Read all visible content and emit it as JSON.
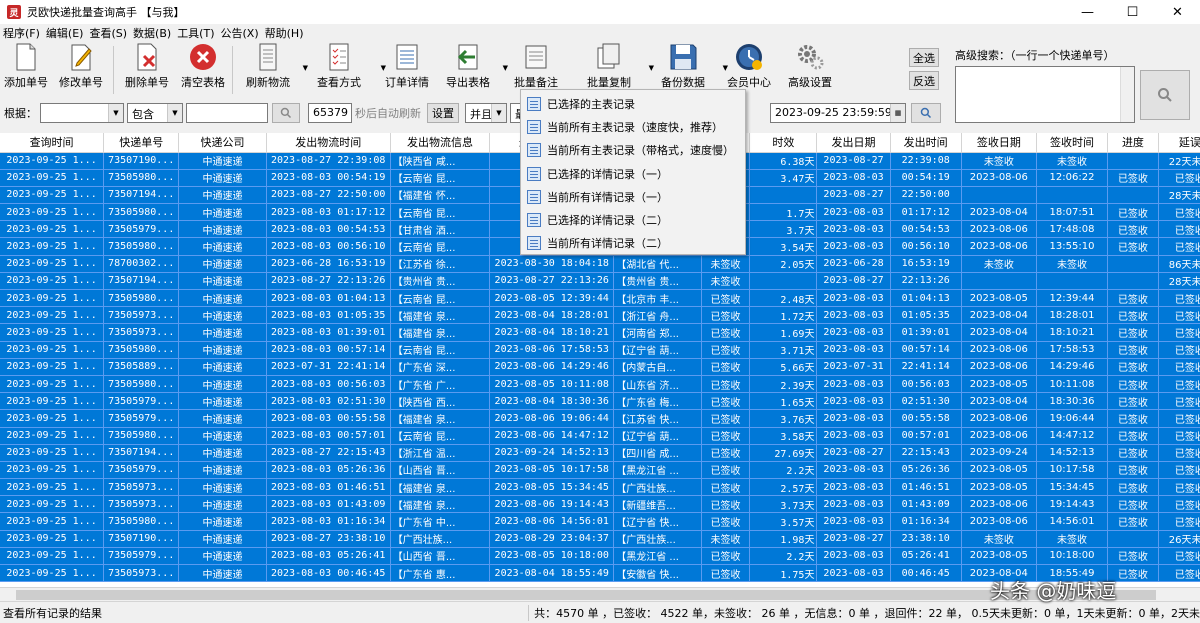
{
  "window": {
    "title": "灵欧快递批量查询高手 【与我】",
    "min": "—",
    "max": "☐",
    "close": "✕",
    "icon_text": "灵"
  },
  "menu": [
    "程序(F)",
    "编辑(E)",
    "查看(S)",
    "数据(B)",
    "工具(T)",
    "公告(X)",
    "帮助(H)"
  ],
  "toolbar": {
    "add": "添加单号",
    "edit": "修改单号",
    "delete": "删除单号",
    "clear": "清空表格",
    "refresh": "刷新物流",
    "view": "查看方式",
    "detail": "订单详情",
    "export": "导出表格",
    "remark": "批量备注",
    "copy": "批量复制",
    "backup": "备份数据",
    "member": "会员中心",
    "settings": "高级设置"
  },
  "side_buttons": {
    "select_all": "全选",
    "invert": "反选"
  },
  "advanced_search": {
    "label": "高级搜索：（一行一个快递单号）"
  },
  "filter": {
    "basis_label": "根据：",
    "basis_value": "",
    "op_value": "包含",
    "keyword": "",
    "seconds": "65379",
    "auto_refresh": "秒后自动刷新",
    "settings_btn": "设置",
    "logic": "并且",
    "last": "最后",
    "date": "2023-09-25  23:59:59"
  },
  "columns": [
    "查询时间",
    "快递单号",
    "快递公司",
    "发出物流时间",
    "发出物流信息",
    "最后物流时间",
    "最后物流信息",
    "状态",
    "时效",
    "发出日期",
    "发出时间",
    "签收日期",
    "签收时间",
    "进度",
    "延误"
  ],
  "rows": [
    [
      "2023-09-25 1...",
      "73507190...",
      "中通速递",
      "2023-08-27 22:39:08",
      "【陕西省 咸...",
      "2023-08...",
      "",
      "",
      "6.38天",
      "2023-08-27",
      "22:39:08",
      "未签收",
      "未签收",
      "",
      "22天未..."
    ],
    [
      "2023-09-25 1...",
      "73505980...",
      "中通速递",
      "2023-08-03 00:54:19",
      "【云南省 昆...",
      "2023-08...",
      "",
      "",
      "3.47天",
      "2023-08-03",
      "00:54:19",
      "2023-08-06",
      "12:06:22",
      "已签收",
      "已签收"
    ],
    [
      "2023-09-25 1...",
      "73507194...",
      "中通速递",
      "2023-08-27 22:50:00",
      "【福建省 怀...",
      "2023-08...",
      "",
      "",
      "",
      "2023-08-27",
      "22:50:00",
      "",
      "",
      "",
      "28天未..."
    ],
    [
      "2023-09-25 1...",
      "73505980...",
      "中通速递",
      "2023-08-03 01:17:12",
      "【云南省 昆...",
      "2023-08...",
      "",
      "",
      "1.7天",
      "2023-08-03",
      "01:17:12",
      "2023-08-04",
      "18:07:51",
      "已签收",
      "已签收"
    ],
    [
      "2023-09-25 1...",
      "73505979...",
      "中通速递",
      "2023-08-03 00:54:53",
      "【甘肃省 酒...",
      "2023-08...",
      "",
      "",
      "3.7天",
      "2023-08-03",
      "00:54:53",
      "2023-08-06",
      "17:48:08",
      "已签收",
      "已签收"
    ],
    [
      "2023-09-25 1...",
      "73505980...",
      "中通速递",
      "2023-08-03 00:56:10",
      "【云南省 昆...",
      "2023-08...",
      "",
      "",
      "3.54天",
      "2023-08-03",
      "00:56:10",
      "2023-08-06",
      "13:55:10",
      "已签收",
      "已签收"
    ],
    [
      "2023-09-25 1...",
      "78700302...",
      "中通速递",
      "2023-06-28 16:53:19",
      "【江苏省 徐...",
      "2023-08-30 18:04:18",
      "【湖北省 代...",
      "未签收",
      "2.05天",
      "2023-06-28",
      "16:53:19",
      "未签收",
      "未签收",
      "",
      "86天未..."
    ],
    [
      "2023-09-25 1...",
      "73507194...",
      "中通速递",
      "2023-08-27 22:13:26",
      "【贵州省 贵...",
      "2023-08-27 22:13:26",
      "【贵州省 贵...",
      "未签收",
      "",
      "2023-08-27",
      "22:13:26",
      "",
      "",
      "",
      "28天未..."
    ],
    [
      "2023-09-25 1...",
      "73505980...",
      "中通速递",
      "2023-08-03 01:04:13",
      "【云南省 昆...",
      "2023-08-05 12:39:44",
      "【北京市 丰...",
      "已签收",
      "2.48天",
      "2023-08-03",
      "01:04:13",
      "2023-08-05",
      "12:39:44",
      "已签收",
      "已签收"
    ],
    [
      "2023-09-25 1...",
      "73505973...",
      "中通速递",
      "2023-08-03 01:05:35",
      "【福建省 泉...",
      "2023-08-04 18:28:01",
      "【浙江省 舟...",
      "已签收",
      "1.72天",
      "2023-08-03",
      "01:05:35",
      "2023-08-04",
      "18:28:01",
      "已签收",
      "已签收"
    ],
    [
      "2023-09-25 1...",
      "73505973...",
      "中通速递",
      "2023-08-03 01:39:01",
      "【福建省 泉...",
      "2023-08-04 18:10:21",
      "【河南省 郑...",
      "已签收",
      "1.69天",
      "2023-08-03",
      "01:39:01",
      "2023-08-04",
      "18:10:21",
      "已签收",
      "已签收"
    ],
    [
      "2023-09-25 1...",
      "73505980...",
      "中通速递",
      "2023-08-03 00:57:14",
      "【云南省 昆...",
      "2023-08-06 17:58:53",
      "【辽宁省 葫...",
      "已签收",
      "3.71天",
      "2023-08-03",
      "00:57:14",
      "2023-08-06",
      "17:58:53",
      "已签收",
      "已签收"
    ],
    [
      "2023-09-25 1...",
      "73505889...",
      "中通速递",
      "2023-07-31 22:41:14",
      "【广东省 深...",
      "2023-08-06 14:29:46",
      "【内蒙古自...",
      "已签收",
      "5.66天",
      "2023-07-31",
      "22:41:14",
      "2023-08-06",
      "14:29:46",
      "已签收",
      "已签收"
    ],
    [
      "2023-09-25 1...",
      "73505980...",
      "中通速递",
      "2023-08-03 00:56:03",
      "【广东省 广...",
      "2023-08-05 10:11:08",
      "【山东省 济...",
      "已签收",
      "2.39天",
      "2023-08-03",
      "00:56:03",
      "2023-08-05",
      "10:11:08",
      "已签收",
      "已签收"
    ],
    [
      "2023-09-25 1...",
      "73505979...",
      "中通速递",
      "2023-08-03 02:51:30",
      "【陕西省 西...",
      "2023-08-04 18:30:36",
      "【广东省 梅...",
      "已签收",
      "1.65天",
      "2023-08-03",
      "02:51:30",
      "2023-08-04",
      "18:30:36",
      "已签收",
      "已签收"
    ],
    [
      "2023-09-25 1...",
      "73505979...",
      "中通速递",
      "2023-08-03 00:55:58",
      "【福建省 泉...",
      "2023-08-06 19:06:44",
      "【江苏省 快...",
      "已签收",
      "3.76天",
      "2023-08-03",
      "00:55:58",
      "2023-08-06",
      "19:06:44",
      "已签收",
      "已签收"
    ],
    [
      "2023-09-25 1...",
      "73505980...",
      "中通速递",
      "2023-08-03 00:57:01",
      "【云南省 昆...",
      "2023-08-06 14:47:12",
      "【辽宁省 葫...",
      "已签收",
      "3.58天",
      "2023-08-03",
      "00:57:01",
      "2023-08-06",
      "14:47:12",
      "已签收",
      "已签收"
    ],
    [
      "2023-09-25 1...",
      "73507194...",
      "中通速递",
      "2023-08-27 22:15:43",
      "【浙江省 温...",
      "2023-09-24 14:52:13",
      "【四川省 成...",
      "已签收",
      "27.69天",
      "2023-08-27",
      "22:15:43",
      "2023-09-24",
      "14:52:13",
      "已签收",
      "已签收"
    ],
    [
      "2023-09-25 1...",
      "73505979...",
      "中通速递",
      "2023-08-03 05:26:36",
      "【山西省 晋...",
      "2023-08-05 10:17:58",
      "【黑龙江省 ...",
      "已签收",
      "2.2天",
      "2023-08-03",
      "05:26:36",
      "2023-08-05",
      "10:17:58",
      "已签收",
      "已签收"
    ],
    [
      "2023-09-25 1...",
      "73505973...",
      "中通速递",
      "2023-08-03 01:46:51",
      "【福建省 泉...",
      "2023-08-05 15:34:45",
      "【广西壮族...",
      "已签收",
      "2.57天",
      "2023-08-03",
      "01:46:51",
      "2023-08-05",
      "15:34:45",
      "已签收",
      "已签收"
    ],
    [
      "2023-09-25 1...",
      "73505973...",
      "中通速递",
      "2023-08-03 01:43:09",
      "【福建省 泉...",
      "2023-08-06 19:14:43",
      "【新疆维吾...",
      "已签收",
      "3.73天",
      "2023-08-03",
      "01:43:09",
      "2023-08-06",
      "19:14:43",
      "已签收",
      "已签收"
    ],
    [
      "2023-09-25 1...",
      "73505980...",
      "中通速递",
      "2023-08-03 01:16:34",
      "【广东省 中...",
      "2023-08-06 14:56:01",
      "【辽宁省 快...",
      "已签收",
      "3.57天",
      "2023-08-03",
      "01:16:34",
      "2023-08-06",
      "14:56:01",
      "已签收",
      "已签收"
    ],
    [
      "2023-09-25 1...",
      "73507190...",
      "中通速递",
      "2023-08-27 23:38:10",
      "【广西壮族...",
      "2023-08-29 23:04:37",
      "【广西壮族...",
      "未签收",
      "1.98天",
      "2023-08-27",
      "23:38:10",
      "未签收",
      "未签收",
      "",
      "26天未..."
    ],
    [
      "2023-09-25 1...",
      "73505979...",
      "中通速递",
      "2023-08-03 05:26:41",
      "【山西省 晋...",
      "2023-08-05 10:18:00",
      "【黑龙江省 ...",
      "已签收",
      "2.2天",
      "2023-08-03",
      "05:26:41",
      "2023-08-05",
      "10:18:00",
      "已签收",
      "已签收"
    ],
    [
      "2023-09-25 1...",
      "73505973...",
      "中通速递",
      "2023-08-03 00:46:45",
      "【广东省 惠...",
      "2023-08-04 18:55:49",
      "【安徽省 快...",
      "已签收",
      "1.75天",
      "2023-08-03",
      "00:46:45",
      "2023-08-04",
      "18:55:49",
      "已签收",
      "已签收"
    ]
  ],
  "dropdown": [
    "已选择的主表记录",
    "当前所有主表记录（速度快，推荐）",
    "当前所有主表记录（带格式，速度慢）",
    "已选择的详情记录（一）",
    "当前所有详情记录（一）",
    "已选择的详情记录（二）",
    "当前所有详情记录（二）"
  ],
  "status": {
    "left": "查看所有记录的结果",
    "right": "共：4570 单 ，已签收： 4522 单，未签收： 26 单 ，无信息：0 单 ，退回件：22 单， 0.5天未更新：0 单，1天未更新：0 单，2天未"
  },
  "watermark": "头条 @奶味逗",
  "colors": {
    "selection": "#0078d7",
    "accent_red": "#d32f2f"
  }
}
